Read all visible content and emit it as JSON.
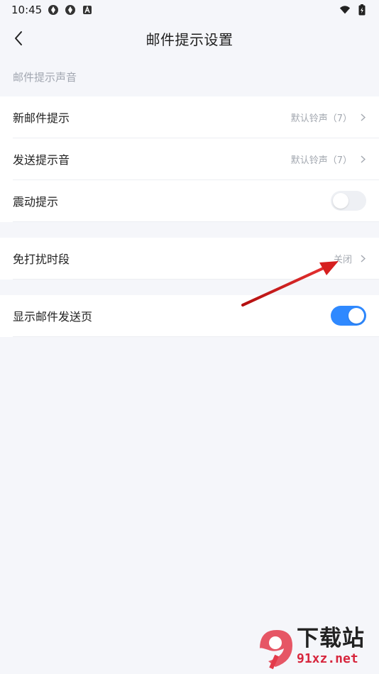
{
  "status_bar": {
    "time": "10:45",
    "icons": [
      "sync-icon",
      "sync-icon",
      "app-a-icon"
    ],
    "right_icons": [
      "wifi-icon",
      "battery-charging-icon"
    ]
  },
  "nav": {
    "title": "邮件提示设置",
    "back_icon": "chevron-left-icon"
  },
  "section_sound": {
    "header": "邮件提示声音"
  },
  "rows": {
    "new_mail": {
      "label": "新邮件提示",
      "value": "默认铃声（7）"
    },
    "send_sound": {
      "label": "发送提示音",
      "value": "默认铃声（7）"
    },
    "vibrate": {
      "label": "震动提示",
      "toggle": "off"
    },
    "dnd": {
      "label": "免打扰时段",
      "value": "关闭"
    },
    "show_send_page": {
      "label": "显示邮件发送页",
      "toggle": "on"
    }
  },
  "colors": {
    "accent": "#2f89ff",
    "background": "#f5f6fa",
    "annotation": "#d61f1f"
  },
  "watermark": {
    "badge_text": "9",
    "cn_text": "下载站",
    "url_text": "91xz.net"
  }
}
